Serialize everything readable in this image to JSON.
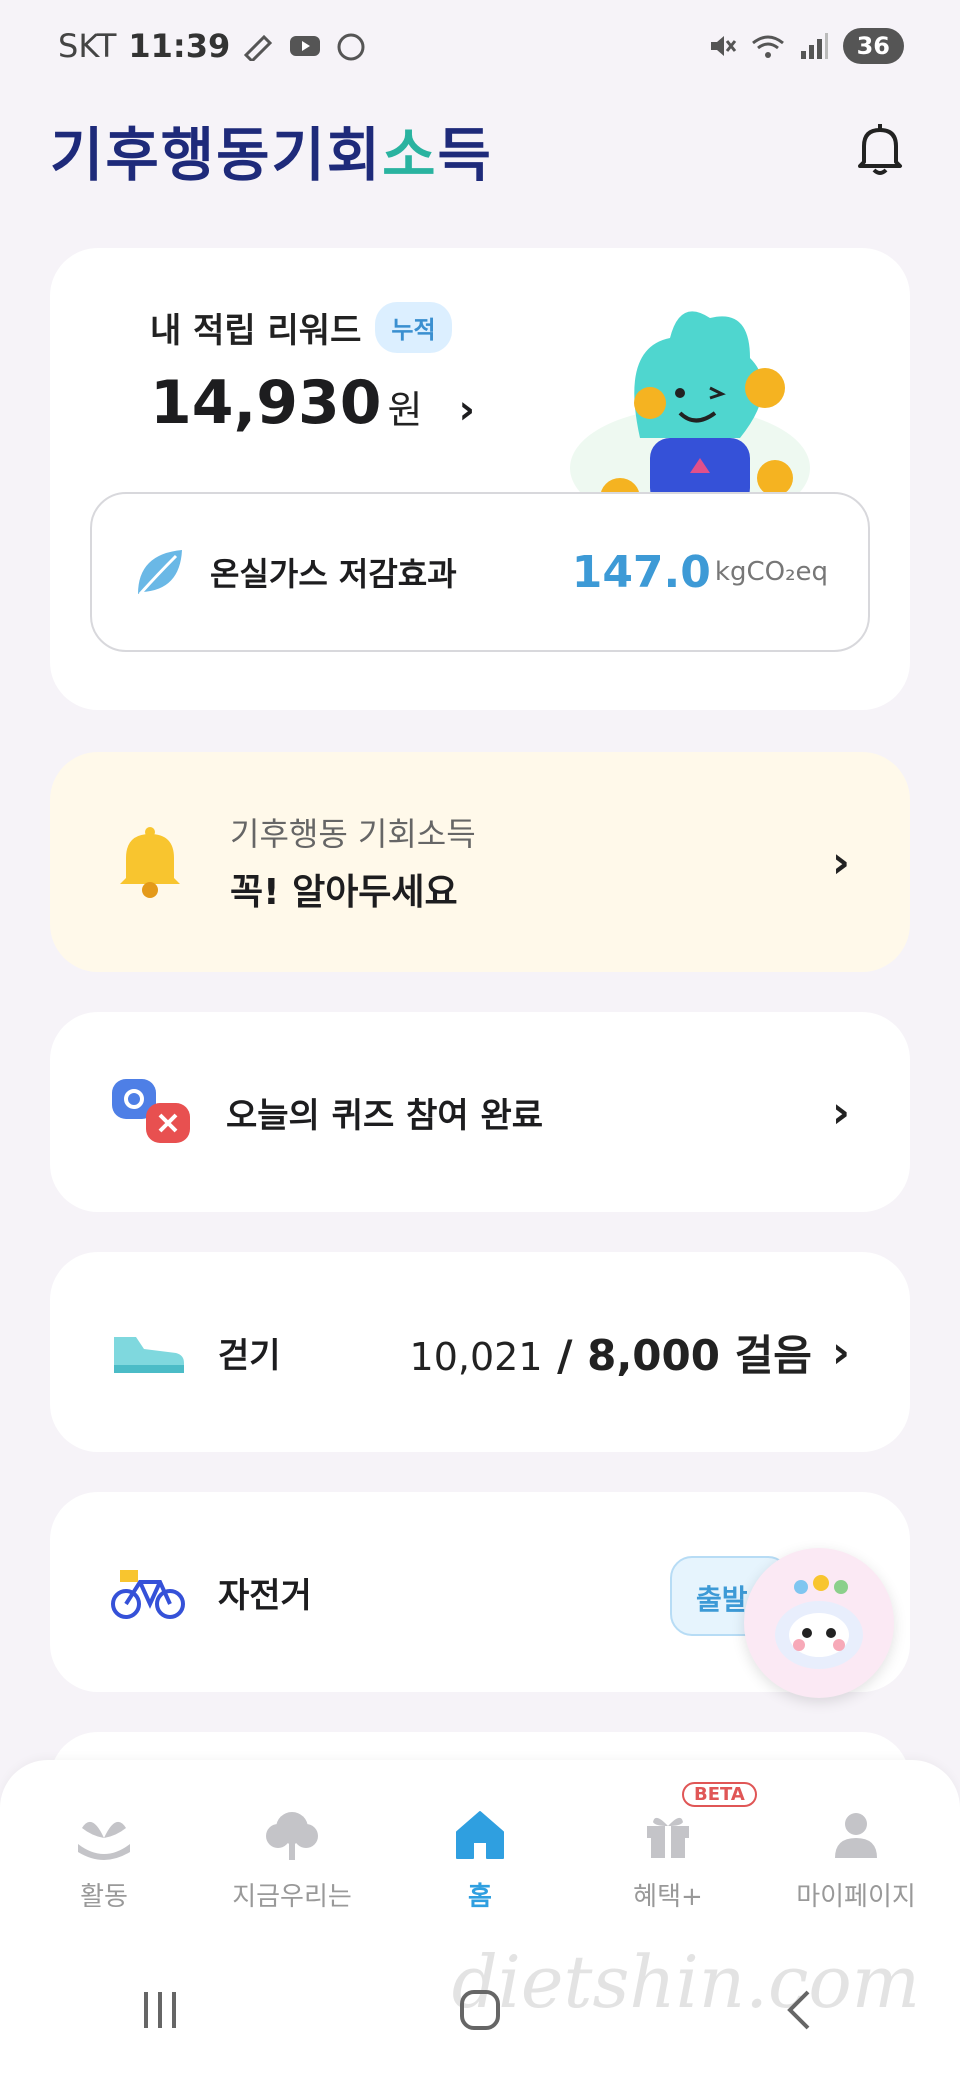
{
  "status_bar": {
    "carrier": "SKT",
    "time": "11:39",
    "battery": "36"
  },
  "header": {
    "logo_prefix": "기후행동기회",
    "logo_accent": "소",
    "logo_suffix": "득"
  },
  "reward": {
    "title": "내 적립 리워드",
    "tag": "누적",
    "amount": "14,930",
    "unit": "원",
    "arrow": "›"
  },
  "ghg": {
    "label": "온실가스 저감효과",
    "value": "147.0",
    "unit": "kgCO₂eq"
  },
  "notice": {
    "subtitle": "기후행동 기회소득",
    "title": "꼭! 알아두세요",
    "chevron": "›"
  },
  "quiz": {
    "label": "오늘의 퀴즈 참여 완료",
    "chevron": "›"
  },
  "walk": {
    "label": "걷기",
    "current": "10,021",
    "separator": " / ",
    "goal": "8,000 걸음",
    "chevron": "›"
  },
  "bike": {
    "label": "자전거",
    "button": "출발"
  },
  "nav": {
    "items": [
      {
        "label": "활동"
      },
      {
        "label": "지금우리는"
      },
      {
        "label": "홈"
      },
      {
        "label": "혜택+",
        "badge": "BETA"
      },
      {
        "label": "마이페이지"
      }
    ]
  },
  "watermark": "dietshin.com",
  "colors": {
    "brand_navy": "#1e2a7a",
    "brand_teal": "#2ab3a0",
    "accent_blue": "#3d9ad6",
    "notice_bg": "#fff9ea",
    "beta_red": "#e05656"
  }
}
